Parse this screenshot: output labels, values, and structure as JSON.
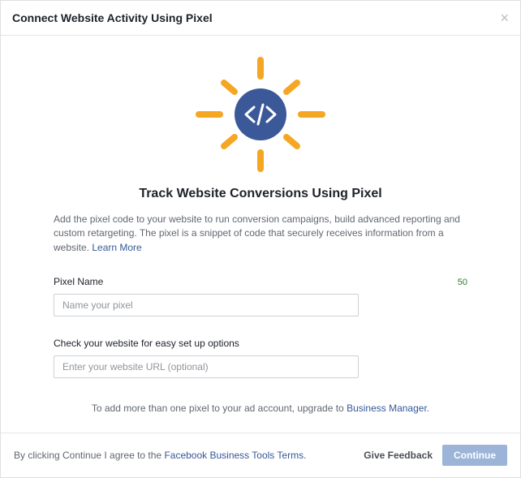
{
  "header": {
    "title": "Connect Website Activity Using Pixel"
  },
  "heading": "Track Website Conversions Using Pixel",
  "description_text": "Add the pixel code to your website to run conversion campaigns, build advanced reporting and custom retargeting. The pixel is a snippet of code that securely receives information from a website. ",
  "learn_more": "Learn More",
  "pixel_name": {
    "label": "Pixel Name",
    "char_count": "50",
    "placeholder": "Name your pixel"
  },
  "website": {
    "label": "Check your website for easy set up options",
    "placeholder": "Enter your website URL (optional)"
  },
  "pixel_info_pre": "To add more than one pixel to your ad account, upgrade to ",
  "pixel_info_link": "Business Manager",
  "pixel_info_post": ".",
  "footer": {
    "terms_pre": "By clicking Continue I agree to the ",
    "terms_link": "Facebook Business Tools Terms.",
    "feedback": "Give Feedback",
    "continue": "Continue"
  }
}
